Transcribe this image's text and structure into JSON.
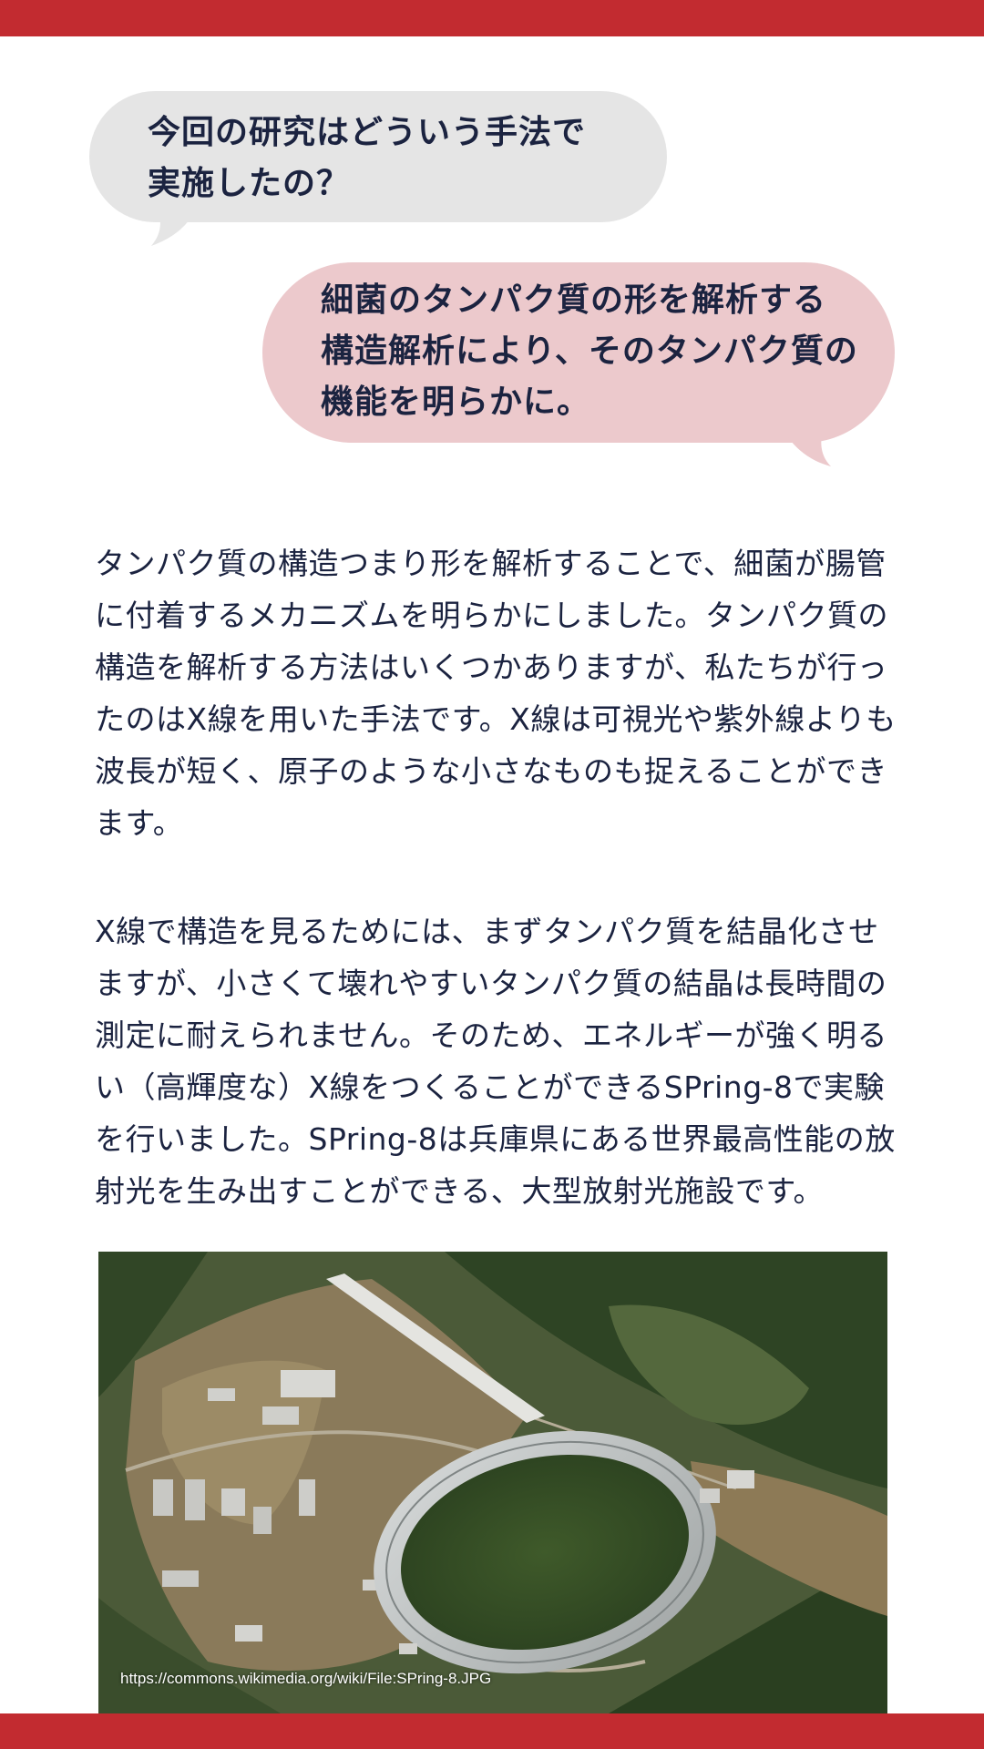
{
  "colors": {
    "accent_bar": "#c22b30",
    "question_bubble": "#e5e5e5",
    "answer_bubble": "#ecc9cc",
    "text": "#1b2340"
  },
  "question": "今回の研究はどういう手法で\n実施したの？",
  "answer": "細菌のタンパク質の形を解析する\n構造解析により、そのタンパク質の\n機能を明らかに。",
  "paragraph1": "タンパク質の構造つまり形を解析することで、細菌が腸管に付着するメカニズムを明らかにしました。タンパク質の構造を解析する方法はいくつかありますが、私たちが行ったのはX線を用いた手法です。X線は可視光や紫外線よりも波長が短く、原子のような小さなものも捉えることができます。",
  "paragraph2": "X線で構造を見るためには、まずタンパク質を結晶化させますが、小さくて壊れやすいタンパク質の結晶は長時間の測定に耐えられません。そのため、エネルギーが強く明るい（高輝度な）X線をつくることができるSPring-8で実験を行いました。SPring-8は兵庫県にある世界最高性能の放射光を生み出すことができる、大型放射光施設です。",
  "photo": {
    "caption": "https://commons.wikimedia.org/wiki/File:SPring-8.JPG"
  }
}
